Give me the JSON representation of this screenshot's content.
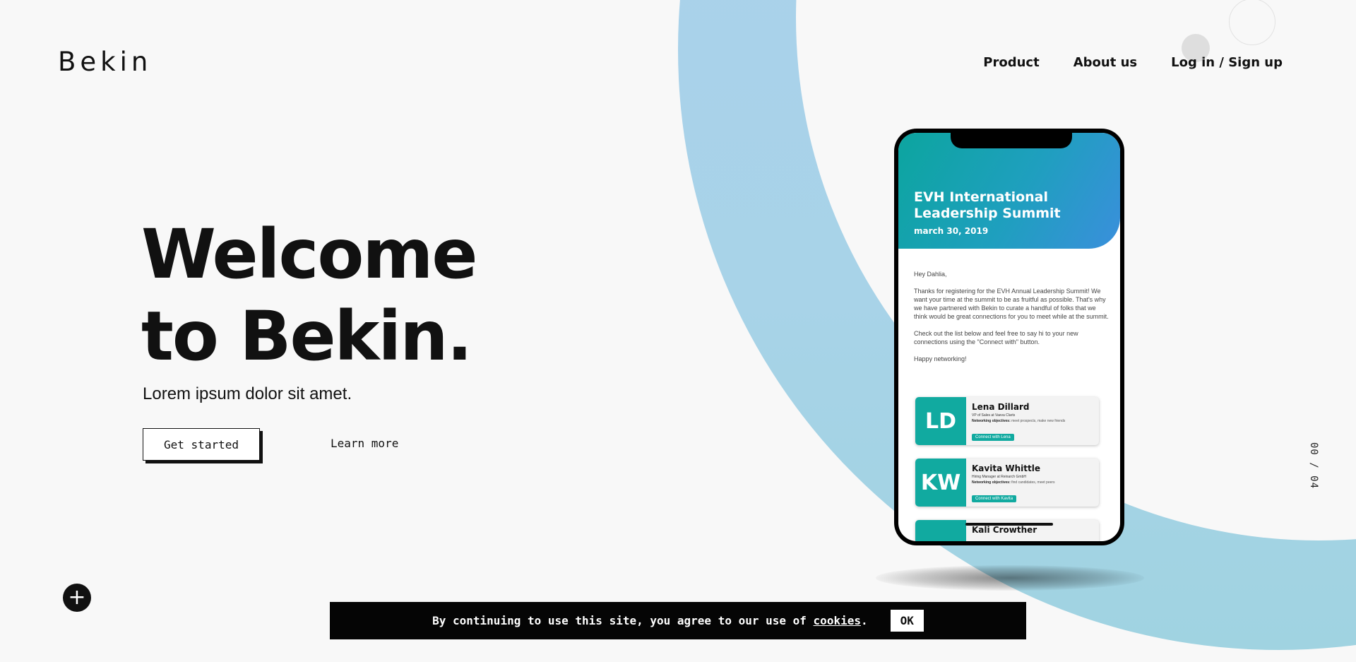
{
  "brand": {
    "logo_text": "Bekin"
  },
  "nav": {
    "items": [
      {
        "label": "Product"
      },
      {
        "label": "About us"
      },
      {
        "label": "Log in / Sign up"
      }
    ]
  },
  "hero": {
    "title_line1": "Welcome",
    "title_line2": "to Bekin.",
    "subtitle": "Lorem ipsum dolor sit amet.",
    "primary_button": "Get started",
    "secondary_button": "Learn more"
  },
  "slide_counter": "00 / 04",
  "plus_button": "+",
  "cookie_banner": {
    "text_before": "By continuing to use this site, you agree to our use of ",
    "link_text": "cookies",
    "text_after": ".",
    "ok_label": "OK"
  },
  "phone": {
    "event_title": "EVH International Leadership Summit",
    "event_date": "march 30, 2019",
    "greeting": "Hey Dahlia,",
    "paragraph1": "Thanks for registering for the EVH Annual Leadership Summit! We want your time at the summit to be as fruitful as possible. That's why we have partnered with Bekin to curate a handful of folks that we think would be great connections for you to meet while at the summit.",
    "paragraph2": "Check out the list below and feel free to say hi to your new connections using the \"Connect with\" button.",
    "signoff": "Happy networking!",
    "objectives_label": "Networking objectives:",
    "cards": [
      {
        "initials": "LD",
        "name": "Lena Dillard",
        "role": "VP of Sales at Vaeva Clarts",
        "objectives": "meet prospects, make new friends",
        "connect_label": "Connect with Lena"
      },
      {
        "initials": "KW",
        "name": "Kavita Whittle",
        "role": "Hiring Manager at Reinarch GmbH",
        "objectives": "find candidates, meet peers",
        "connect_label": "Connect with Kavita"
      },
      {
        "initials": "",
        "name": "Kali Crowther",
        "role": "",
        "objectives": "",
        "connect_label": ""
      }
    ]
  },
  "colors": {
    "background": "#f8f8f8",
    "arc_blue": "#acd0ee",
    "teal": "#11aaa0",
    "header_gradient_end": "#3a8fdc",
    "dark": "#111111"
  }
}
